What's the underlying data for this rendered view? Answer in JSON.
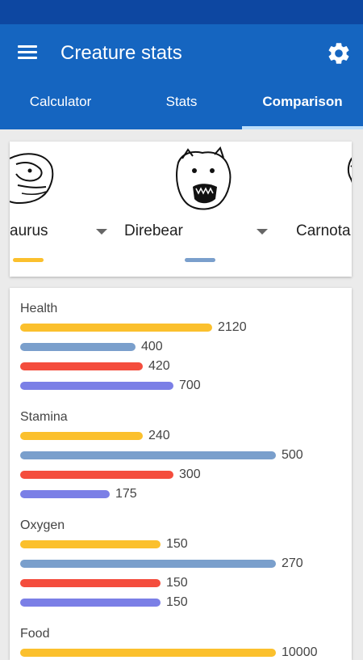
{
  "app": {
    "title": "Creature stats"
  },
  "colors": {
    "appbar": "#1565c0",
    "statusbar": "#0d47a1",
    "creature1": "#fbc02d",
    "creature2": "#7a9fcc",
    "creature3": "#f44d3d",
    "creature4": "#7b7fe6"
  },
  "icons": {
    "menu": "menu-icon",
    "settings": "gear-icon"
  },
  "tabs": [
    {
      "label": "Calculator",
      "active": false
    },
    {
      "label": "Stats",
      "active": false
    },
    {
      "label": "Comparison",
      "active": true
    }
  ],
  "creatures": [
    {
      "name": "Therizinosaurus",
      "visible_name": "aurus",
      "color": "#fbc02d"
    },
    {
      "name": "Direbear",
      "visible_name": "Direbear",
      "color": "#7a9fcc"
    },
    {
      "name": "Carnotaurus",
      "visible_name": "Carnota",
      "color": "#f44d3d"
    }
  ],
  "stats": [
    {
      "label": "Health",
      "values": [
        "2120",
        "400",
        "420",
        "700"
      ]
    },
    {
      "label": "Stamina",
      "values": [
        "240",
        "500",
        "300",
        "175"
      ]
    },
    {
      "label": "Oxygen",
      "values": [
        "150",
        "270",
        "150",
        "150"
      ]
    },
    {
      "label": "Food",
      "values": [
        "10000",
        "",
        "",
        ""
      ]
    }
  ],
  "bar_fill": {
    "Health": [
      0.75,
      0.45,
      0.48,
      0.6
    ],
    "Stamina": [
      0.48,
      1.0,
      0.6,
      0.35
    ],
    "Oxygen": [
      0.55,
      1.0,
      0.55,
      0.55
    ],
    "Food": [
      1.0,
      0,
      0,
      0
    ]
  }
}
